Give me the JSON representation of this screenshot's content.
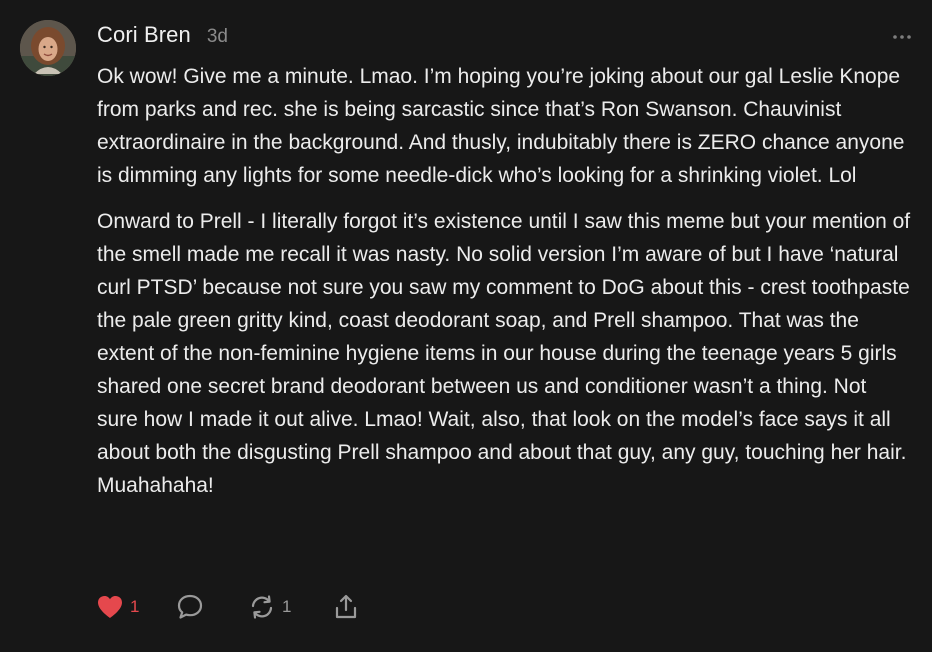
{
  "comment": {
    "author": "Cori Bren",
    "time": "3d",
    "paragraphs": [
      "Ok wow! Give me a minute. Lmao. I’m hoping you’re joking about our gal Leslie Knope from parks and rec. she is being sarcastic since that’s Ron Swanson. Chauvinist extraordinaire in the background. And thusly, indubitably there is ZERO chance anyone is dimming any lights for some needle-dick who’s looking for a shrinking violet. Lol",
      "Onward to Prell - I literally forgot it’s existence until I saw this meme but your mention of the smell made me recall it was nasty. No solid version I’m aware of but I have ‘natural curl PTSD’ because not sure you saw my comment to DoG about this - crest toothpaste the pale green gritty kind, coast deodorant soap, and Prell shampoo. That was the extent of the non-feminine hygiene items in our house during the teenage years 5 girls shared one secret brand deodorant between us and conditioner wasn’t a thing. Not sure how I made it out alive. Lmao! Wait, also, that look on the model’s face says it all about both the disgusting Prell shampoo and about that guy, any guy, touching her hair. Muahahaha!"
    ],
    "actions": {
      "like_count": "1",
      "restack_count": "1"
    }
  },
  "icons": {
    "avatar": "profile-photo",
    "more": "more-horizontal-icon",
    "like": "heart-icon",
    "reply": "comment-bubble-icon",
    "restack": "restack-icon",
    "share": "share-icon"
  },
  "colors": {
    "background": "#171717",
    "text": "#ececec",
    "muted": "#8a8a8a",
    "like_active": "#e5484d"
  }
}
